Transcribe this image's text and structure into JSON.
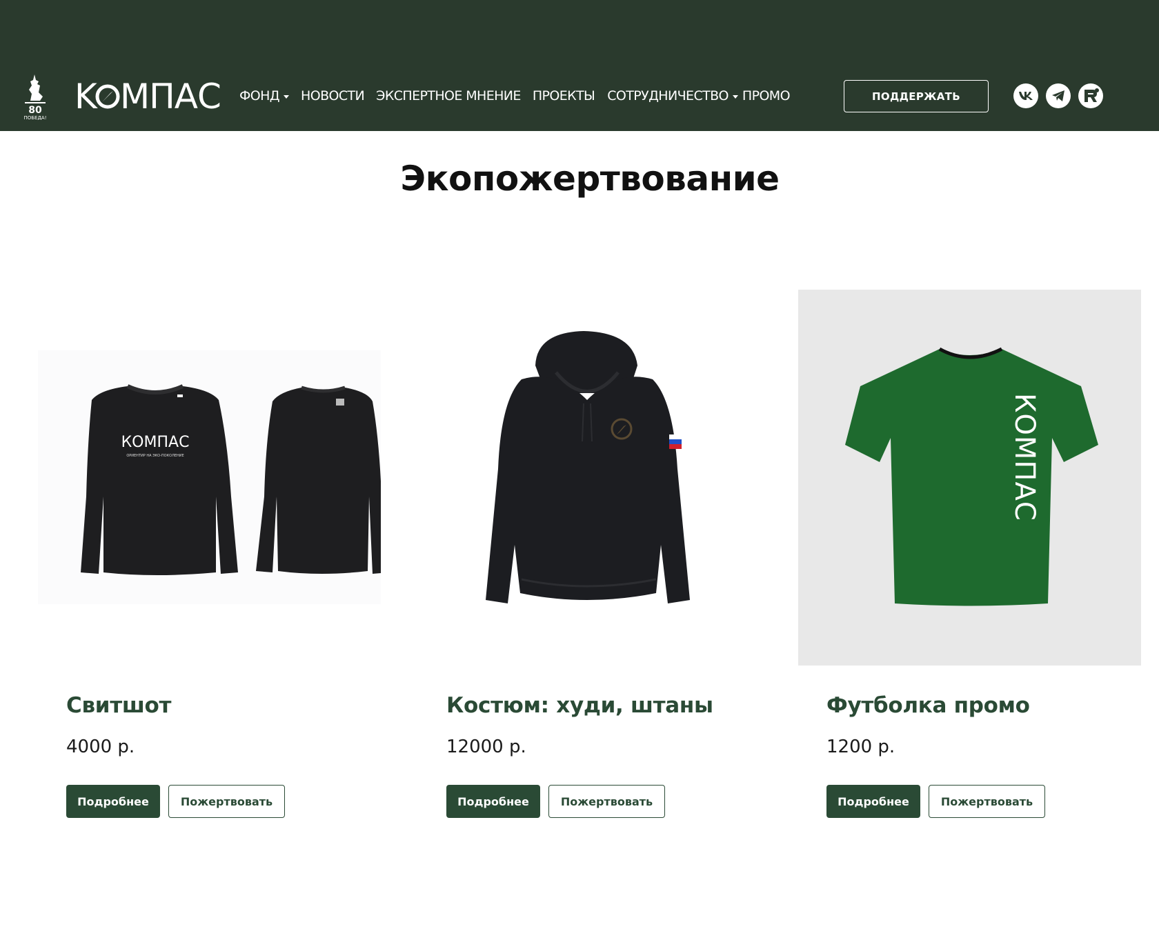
{
  "header": {
    "badge_text": "80 ПОБЕДА!",
    "logo_text": "КОМПАС",
    "nav": [
      {
        "label": "ФОНД",
        "dropdown": true
      },
      {
        "label": "НОВОСТИ",
        "dropdown": false
      },
      {
        "label": "ЭКСПЕРТНОЕ МНЕНИЕ",
        "dropdown": false
      },
      {
        "label": "ПРОЕКТЫ",
        "dropdown": false
      },
      {
        "label": "СОТРУДНИЧЕСТВО",
        "dropdown": true
      },
      {
        "label": "ПРОМО",
        "dropdown": false
      }
    ],
    "support_label": "ПОДДЕРЖАТЬ",
    "social_icons": [
      "vk-icon",
      "telegram-icon",
      "rutube-icon"
    ]
  },
  "page": {
    "title": "Экопожертвование"
  },
  "products": [
    {
      "name": "Свитшот",
      "price": "4000 р.",
      "more_label": "Подробнее",
      "donate_label": "Пожертвовать",
      "print_text": "КОМПАС",
      "print_subtext": "ОРИЕНТИР НА ЭКО-ПОКОЛЕНИЕ"
    },
    {
      "name": "Костюм: худи, штаны",
      "price": "12000 р.",
      "more_label": "Подробнее",
      "donate_label": "Пожертвовать"
    },
    {
      "name": "Футболка промо",
      "price": "1200 р.",
      "more_label": "Подробнее",
      "donate_label": "Пожертвовать",
      "print_text": "КОМПАС"
    }
  ],
  "colors": {
    "header_bg": "#2a3a2d",
    "accent": "#2a4a35",
    "tshirt": "#1e6a2e",
    "garment": "#1f1f22"
  }
}
